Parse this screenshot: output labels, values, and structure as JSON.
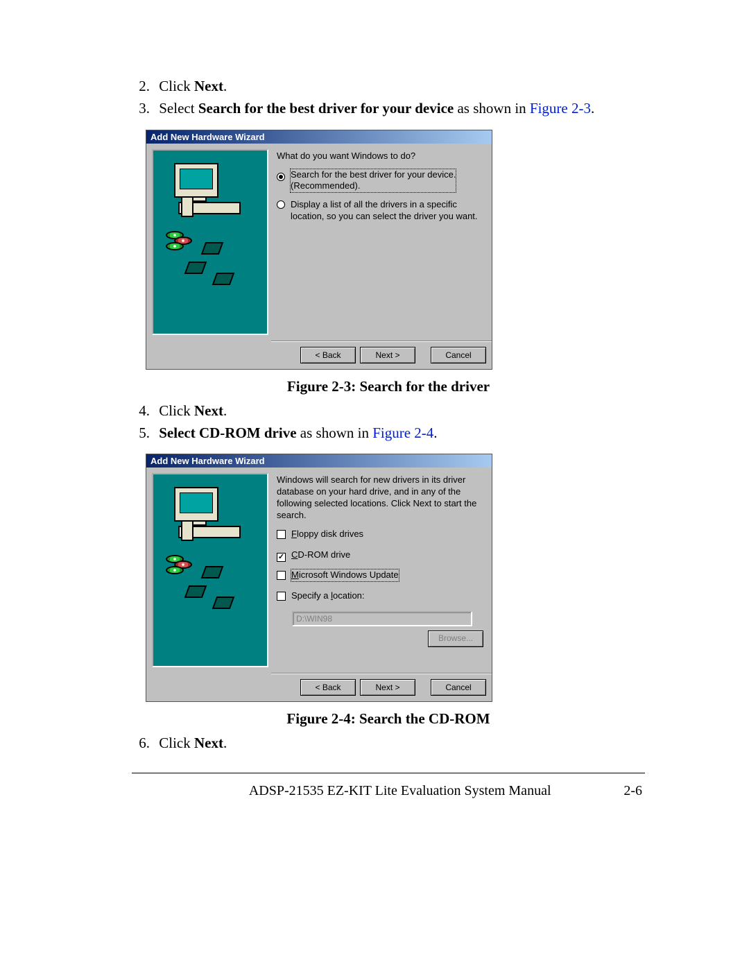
{
  "steps": {
    "s2": {
      "num": "2.",
      "prefix": "Click ",
      "bold": "Next",
      "suffix": "."
    },
    "s3": {
      "num": "3.",
      "prefix": "Select ",
      "bold": "Search for the best driver for your device",
      "suffix": " as shown in ",
      "figlink": "Figure 2-3",
      "end": "."
    },
    "s4": {
      "num": "4.",
      "prefix": "Click ",
      "bold": "Next",
      "suffix": "."
    },
    "s5": {
      "num": "5.",
      "bold": "Select CD-ROM drive",
      "suffix": " as shown in ",
      "figlink": "Figure 2-4",
      "end": "."
    },
    "s6": {
      "num": "6.",
      "prefix": "Click ",
      "bold": "Next",
      "suffix": "."
    }
  },
  "captions": {
    "fig23": "Figure 2-3: Search for the driver",
    "fig24": "Figure 2-4: Search the CD-ROM"
  },
  "wizard1": {
    "title": "Add New Hardware Wizard",
    "prompt": "What do you want Windows to do?",
    "opt1a": "Search for the best driver for your device.",
    "opt1b": "(Recommended).",
    "opt2": "Display a list of all the drivers in a specific location, so you can select the driver you want.",
    "back": "< Back",
    "next": "Next >",
    "cancel": "Cancel"
  },
  "wizard2": {
    "title": "Add New Hardware Wizard",
    "prompt": "Windows will search for new drivers in its driver database on your hard drive, and in any of the following selected locations. Click Next to start the search.",
    "floppy": "Floppy disk drives",
    "cdrom": "CD-ROM drive",
    "mswu": "Microsoft Windows Update",
    "specify": "Specify a location:",
    "path": "D:\\WIN98",
    "browse": "Browse...",
    "back": "< Back",
    "next": "Next >",
    "cancel": "Cancel"
  },
  "footer": {
    "title": "ADSP-21535 EZ-KIT Lite Evaluation System Manual",
    "page": "2-6"
  }
}
